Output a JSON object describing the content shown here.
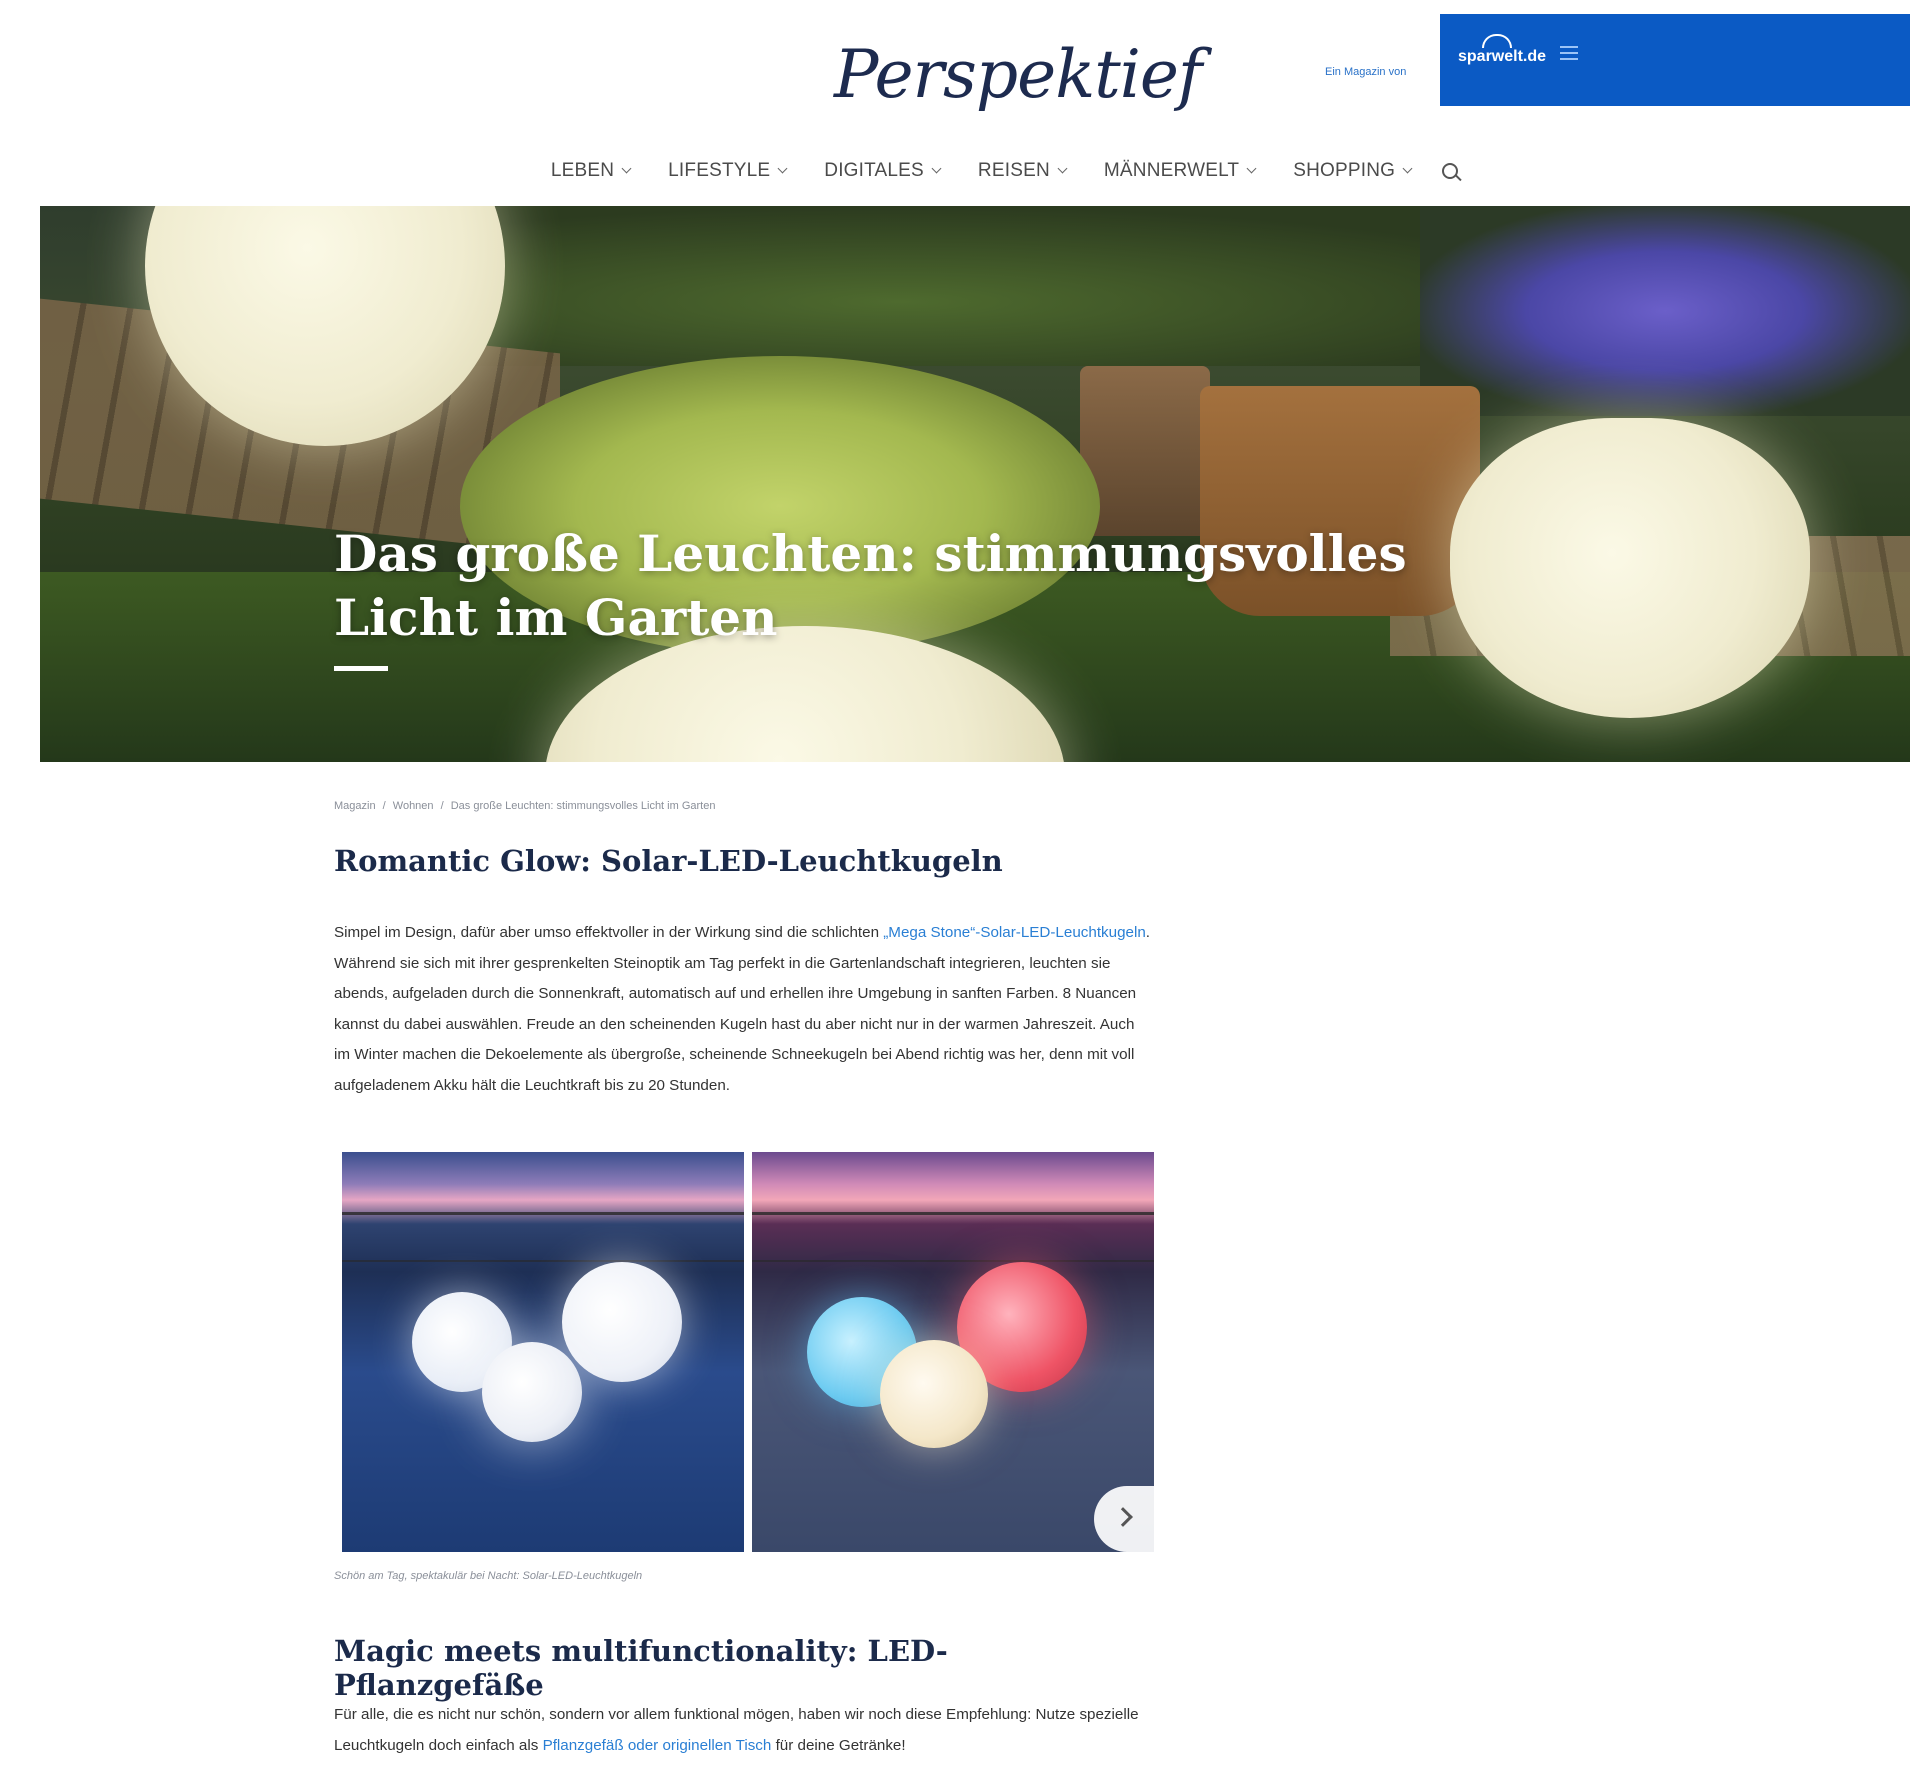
{
  "header": {
    "logo": "Perspektief",
    "by_text": "Ein Magazin von",
    "brand": "sparwelt.de"
  },
  "nav": {
    "items": [
      "LEBEN",
      "LIFESTYLE",
      "DIGITALES",
      "REISEN",
      "MÄNNERWELT",
      "SHOPPING"
    ]
  },
  "hero": {
    "title": "Das große Leuchten: stimmungsvolles Licht im Garten"
  },
  "breadcrumb": {
    "items": [
      "Magazin",
      "/",
      "Wohnen",
      "/",
      "Das große Leuchten: stimmungsvolles Licht im Garten"
    ]
  },
  "article": {
    "section1": {
      "heading": "Romantic Glow: Solar-LED-Leuchtkugeln",
      "para_before_link": "Simpel im Design, dafür aber umso effektvoller in der Wirkung sind die schlichten ",
      "link": "„Mega Stone“-Solar-LED-Leuchtkugeln",
      "para_after_link": ". Während sie sich mit ihrer gesprenkelten Steinoptik am Tag perfekt in die Gartenlandschaft integrieren, leuchten sie abends, aufgeladen durch die Sonnenkraft, automatisch auf und erhellen ihre Umgebung in sanften Farben. 8 Nuancen kannst du dabei auswählen. Freude an den scheinenden Kugeln hast du aber nicht nur in der warmen Jahreszeit. Auch im Winter machen die Dekoelemente als übergroße, scheinende Schneekugeln bei Abend richtig was her, denn mit voll aufgeladenem Akku hält die Leuchtkraft bis zu 20 Stunden."
    },
    "gallery_caption": "Schön am Tag, spektakulär bei Nacht: Solar-LED-Leuchtkugeln",
    "section2": {
      "heading": "Magic meets multifunctionality: LED-Pflanzgefäße",
      "para_before_link": "Für alle, die es nicht nur schön, sondern vor allem funktional mögen, haben wir noch diese Empfehlung: Nutze spezielle Leuchtkugeln doch einfach als ",
      "link": "Pflanzgefäß oder originellen Tisch",
      "para_after_link": " für deine Getränke!"
    }
  },
  "colors": {
    "brand_blue": "#0b5ac4",
    "heading_navy": "#1b2a4a",
    "link_blue": "#2a7fd4"
  }
}
